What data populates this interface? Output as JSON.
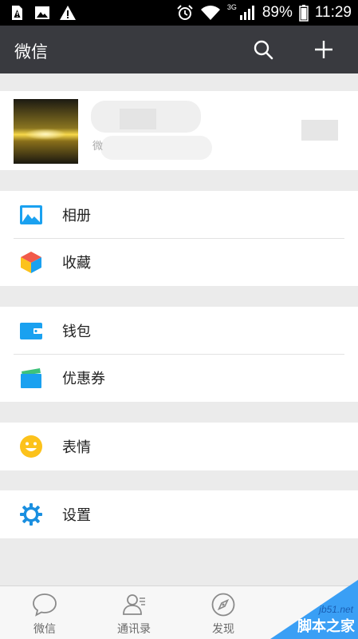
{
  "status_bar": {
    "network": "3G",
    "battery": "89%",
    "time": "11:29"
  },
  "header": {
    "title": "微信",
    "search_icon": "search-icon",
    "add_icon": "plus-icon"
  },
  "profile": {
    "avatar": "sunset-avatar",
    "name_partial": "微"
  },
  "menu_groups": [
    {
      "items": [
        {
          "label": "相册",
          "icon": "photo-album-icon"
        },
        {
          "label": "收藏",
          "icon": "favorites-cube-icon"
        }
      ]
    },
    {
      "items": [
        {
          "label": "钱包",
          "icon": "wallet-icon"
        },
        {
          "label": "优惠券",
          "icon": "coupon-icon"
        }
      ]
    },
    {
      "items": [
        {
          "label": "表情",
          "icon": "smiley-icon"
        }
      ]
    },
    {
      "items": [
        {
          "label": "设置",
          "icon": "settings-gear-icon"
        }
      ]
    }
  ],
  "tab_bar": {
    "tabs": [
      {
        "label": "微信",
        "icon": "chat-bubble-icon"
      },
      {
        "label": "通讯录",
        "icon": "contacts-icon"
      },
      {
        "label": "发现",
        "icon": "compass-icon"
      }
    ]
  },
  "watermark": {
    "url": "jb51.net",
    "name": "脚本之家"
  },
  "colors": {
    "header_bg": "#393a3f",
    "page_bg": "#ebebeb",
    "accent_blue": "#1aa1f0",
    "smiley_yellow": "#fcc21b"
  }
}
